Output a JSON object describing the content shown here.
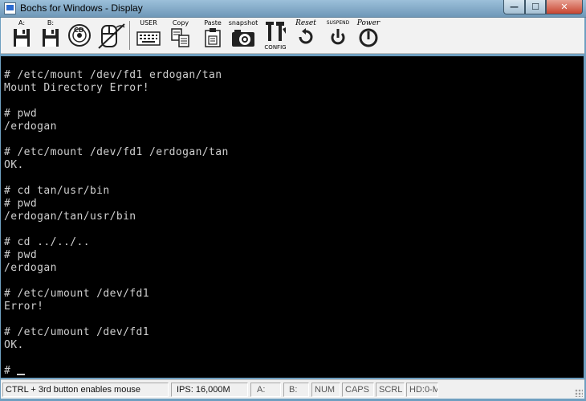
{
  "window": {
    "title": "Bochs for Windows - Display",
    "min_glyph": "—",
    "max_glyph": "☐",
    "close_glyph": "✕"
  },
  "toolbar": {
    "floppy_a": "A:",
    "floppy_b": "B:",
    "cdrom": "CD",
    "mouse_icon": "mouse-icon",
    "user": "USER",
    "copy": "Copy",
    "paste": "Paste",
    "snapshot": "snapshot",
    "config": "CONFIG",
    "reset": "Reset",
    "suspend": "SUSPEND",
    "power": "Power"
  },
  "console": {
    "lines": [
      "# /etc/mount /dev/fd1 erdogan/tan",
      "Mount Directory Error!",
      "",
      "# pwd",
      "/erdogan",
      "",
      "# /etc/mount /dev/fd1 /erdogan/tan",
      "OK.",
      "",
      "# cd tan/usr/bin",
      "# pwd",
      "/erdogan/tan/usr/bin",
      "",
      "# cd ../../..",
      "# pwd",
      "/erdogan",
      "",
      "# /etc/umount /dev/fd1",
      "Error!",
      "",
      "# /etc/umount /dev/fd1",
      "OK.",
      "",
      "#"
    ]
  },
  "status": {
    "hint": "CTRL + 3rd button enables mouse",
    "ips": "IPS: 16,000M",
    "a": "A:",
    "b": "B:",
    "num": "NUM",
    "caps": "CAPS",
    "scrl": "SCRL",
    "hd": "HD:0-M"
  }
}
